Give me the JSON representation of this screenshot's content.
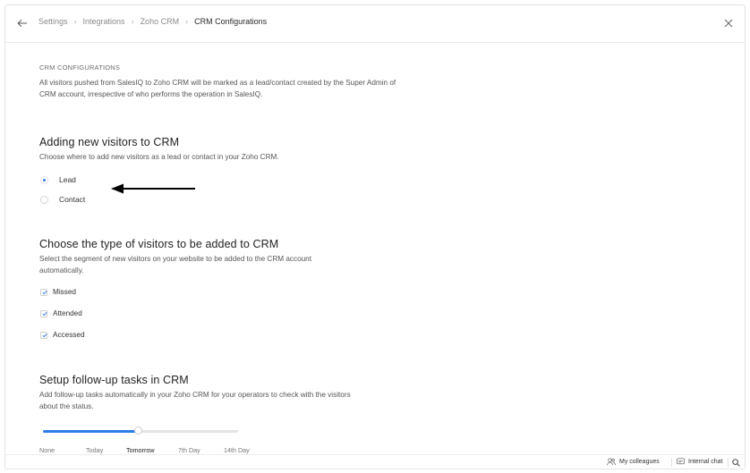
{
  "breadcrumb": [
    "Settings",
    "Integrations",
    "Zoho CRM",
    "CRM Configurations"
  ],
  "crm_config": {
    "section_label": "CRM CONFIGURATIONS",
    "description": "All visitors pushed from SalesIQ to Zoho CRM will be marked as a lead/contact created by the Super Admin of CRM account, irrespective of who performs the operation in SalesIQ."
  },
  "adding_visitors": {
    "title": "Adding new visitors to CRM",
    "description": "Choose where to add new visitors as a lead or contact in your Zoho CRM.",
    "options": [
      {
        "label": "Lead",
        "selected": true
      },
      {
        "label": "Contact",
        "selected": false
      }
    ]
  },
  "visitor_type": {
    "title": "Choose the type of visitors to be added to CRM",
    "description": "Select the segment of new visitors on your website to be added to the CRM account automatically.",
    "options": [
      {
        "label": "Missed",
        "checked": true
      },
      {
        "label": "Attended",
        "checked": true
      },
      {
        "label": "Accessed",
        "checked": true
      }
    ]
  },
  "followup": {
    "title": "Setup follow-up tasks in CRM",
    "description": "Add follow-up tasks automatically in your Zoho CRM for your operators to check with the visitors about the status.",
    "slider_labels": [
      "None",
      "Today",
      "Tomorrow",
      "7th Day",
      "14th Day"
    ],
    "slider_selected": "Tomorrow"
  },
  "bottom_bar": {
    "colleagues": "My colleagues",
    "internal_chat": "Internal chat"
  },
  "colors": {
    "accent": "#2d7be6",
    "text": "#222222"
  }
}
